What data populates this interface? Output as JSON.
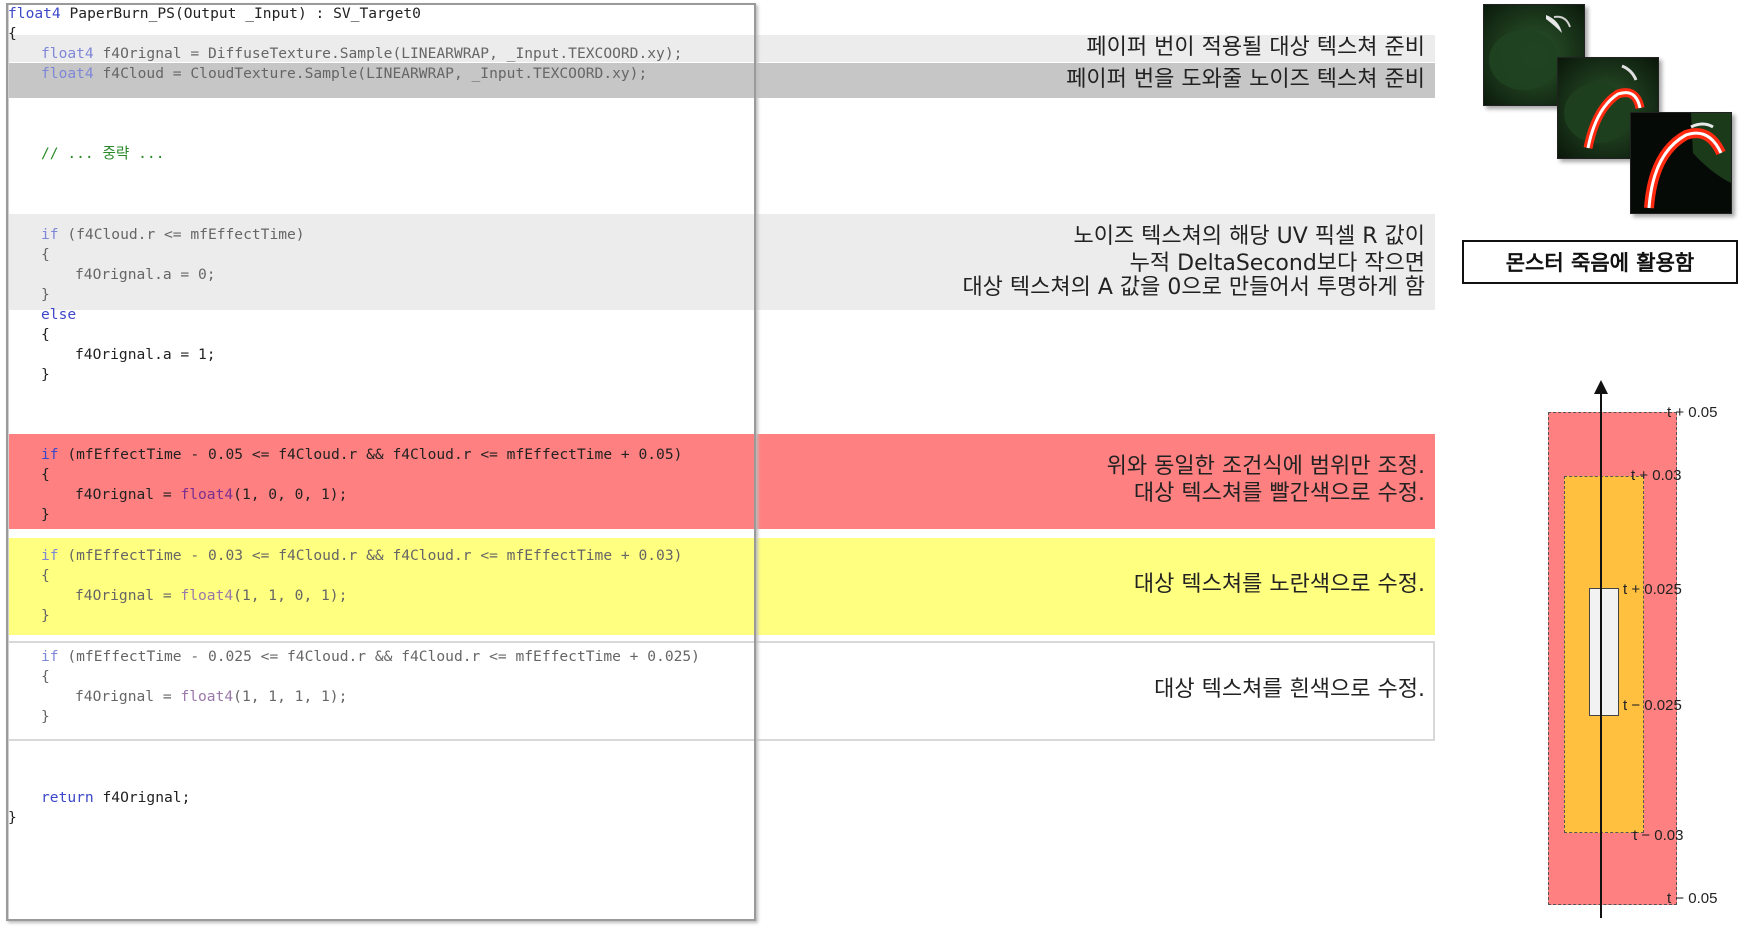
{
  "code": {
    "signature": "float4 PaperBurn_PS(Output _Input) : SV_Target0",
    "lines": {
      "open_brace": "{",
      "diffuse_type": "float4",
      "diffuse_rest": " f4Orignal = DiffuseTexture.Sample(LINEARWRAP, _Input.TEXCOORD.xy);",
      "cloud_type": "float4",
      "cloud_rest": " f4Cloud = CloudTexture.Sample(LINEARWRAP, _Input.TEXCOORD.xy);",
      "comment": "// ... 중략 ...",
      "if1_kw": "if",
      "if1_rest": " (f4Cloud.r <= mfEffectTime)",
      "if1_open": "{",
      "if1_body": "f4Orignal.a = 0;",
      "if1_close": "}",
      "else_kw": "else",
      "else_open": "{",
      "else_body": "f4Orignal.a = 1;",
      "else_close": "}",
      "red_kw": "if",
      "red_rest": " (mfEffectTime - 0.05 <= f4Cloud.r && f4Cloud.r <= mfEffectTime + 0.05)",
      "red_open": "{",
      "red_body_a": "f4Orignal = ",
      "red_body_fn": "float4",
      "red_body_b": "(1, 0, 0, 1);",
      "red_close": "}",
      "yellow_kw": "if",
      "yellow_rest": " (mfEffectTime - 0.03 <= f4Cloud.r && f4Cloud.r <= mfEffectTime + 0.03)",
      "yellow_open": "{",
      "yellow_body_a": "f4Orignal = ",
      "yellow_body_fn": "float4",
      "yellow_body_b": "(1, 1, 0, 1);",
      "yellow_close": "}",
      "white_kw": "if",
      "white_rest": " (mfEffectTime - 0.025 <= f4Cloud.r && f4Cloud.r <= mfEffectTime + 0.025)",
      "white_open": "{",
      "white_body_a": "f4Orignal = ",
      "white_body_fn": "float4",
      "white_body_b": "(1, 1, 1, 1);",
      "white_close": "}",
      "return_kw": "return",
      "return_rest": " f4Orignal;",
      "close_brace": "}"
    }
  },
  "annotations": {
    "target_texture": "페이퍼 번이 적용될 대상 텍스쳐 준비",
    "noise_texture": "페이퍼 번을 도와줄 노이즈 텍스쳐 준비",
    "alpha_rule_1": "노이즈 텍스쳐의 해당 UV 픽셀 R 값이",
    "alpha_rule_2": "누적 DeltaSecond보다 작으면",
    "alpha_rule_3": "대상 텍스쳐의 A 값을 0으로 만들어서 투명하게 함",
    "red_1": "위와 동일한 조건식에 범위만 조정.",
    "red_2": "대상 텍스쳐를 빨간색으로 수정.",
    "yellow": "대상 텍스쳐를 노란색으로 수정.",
    "white": "대상 텍스쳐를 흰색으로 수정."
  },
  "caption": "몬스터 죽음에 활용함",
  "range_diagram": {
    "labels": {
      "plus_005": "t + 0.05",
      "plus_003": "t + 0.03",
      "plus_0025": "t + 0.025",
      "minus_0025": "t − 0.025",
      "minus_003": "t − 0.03",
      "minus_005": "t − 0.05"
    },
    "bands": [
      {
        "name": "red",
        "half_width": 0.05,
        "color": "#ff8080"
      },
      {
        "name": "yellow",
        "half_width": 0.03,
        "color": "#ffc040"
      },
      {
        "name": "white",
        "half_width": 0.025,
        "color": "#f2f2f2"
      }
    ]
  },
  "colors": {
    "band_light_gray": "#ececec",
    "band_mid_gray": "#c6c6c6",
    "band_red": "#ff8080",
    "band_yellow": "#ffff80",
    "keyword_blue": "#3c48c8",
    "comment_green": "#2a8a2a"
  },
  "icons": [
    "monster-burn-frame-1",
    "monster-burn-frame-2",
    "monster-burn-frame-3",
    "axis-up-arrow-icon"
  ]
}
